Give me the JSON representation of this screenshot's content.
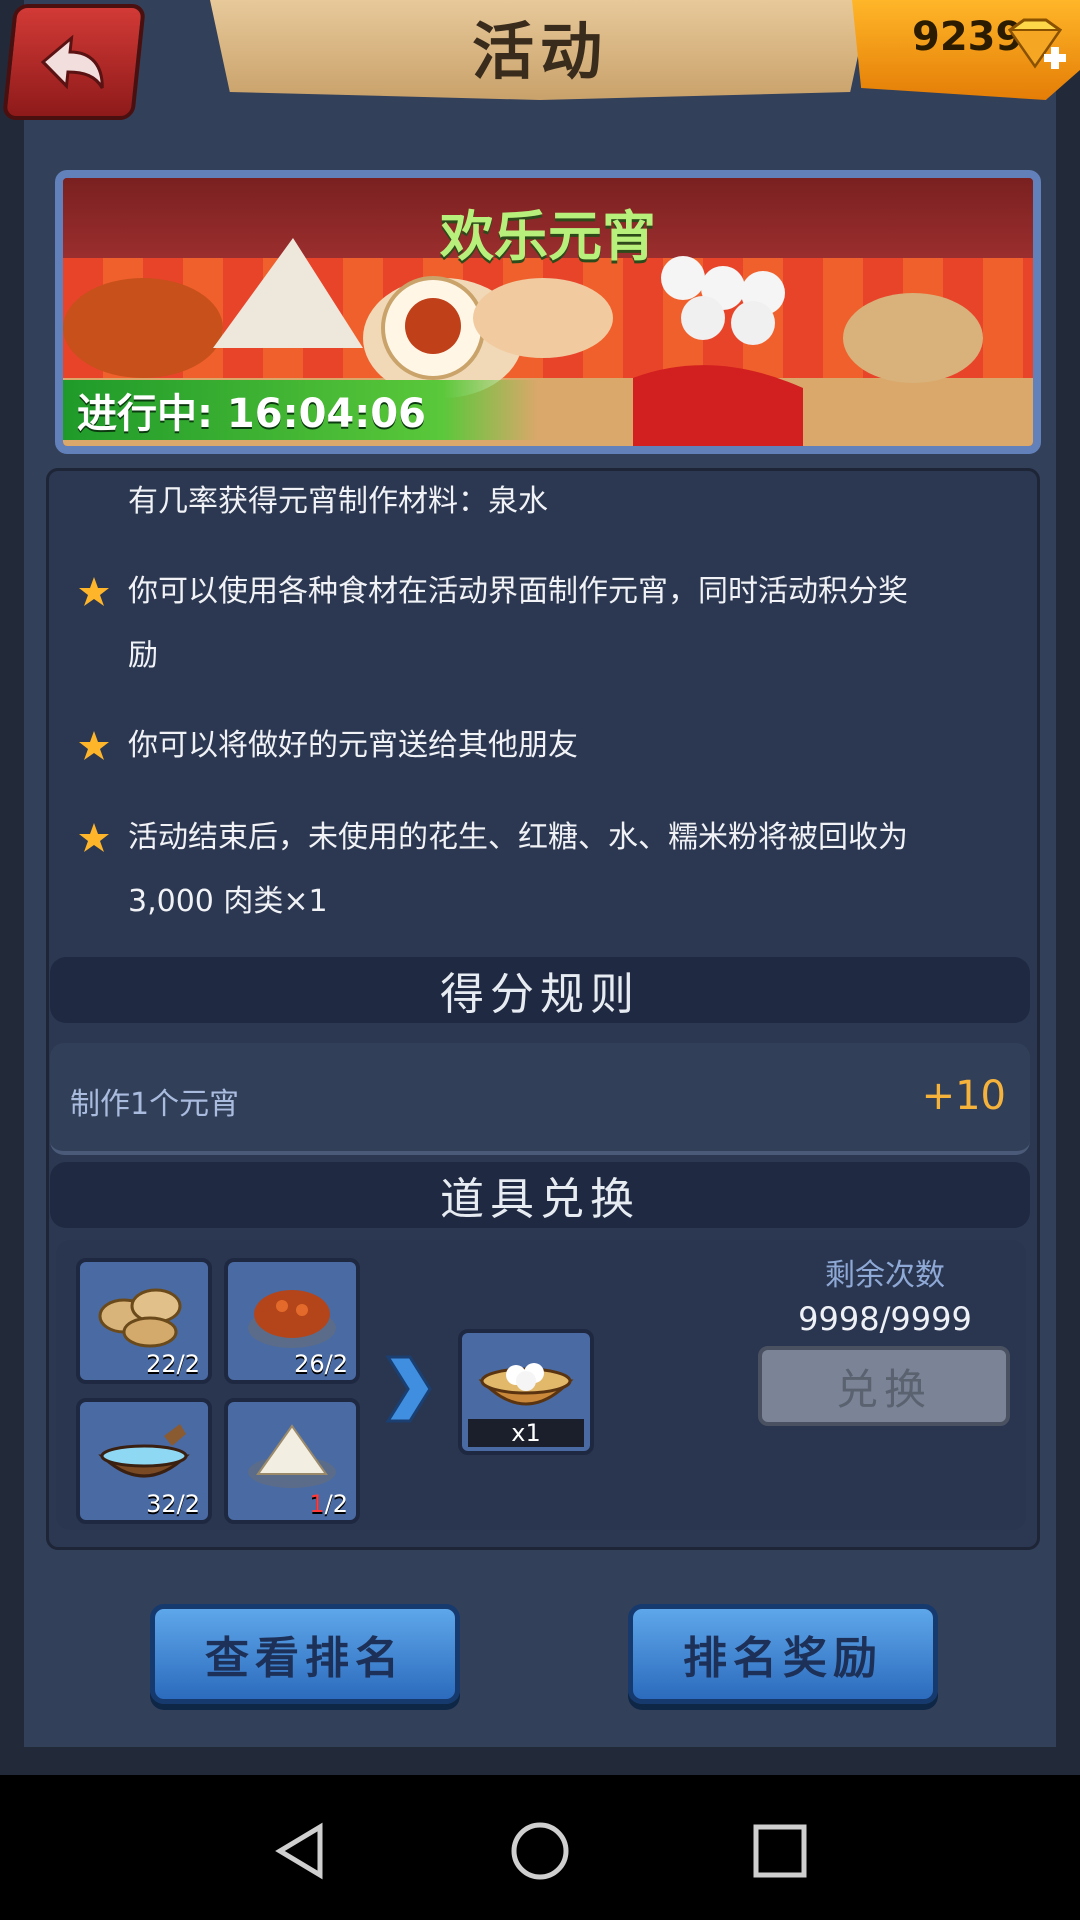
{
  "header": {
    "title": "活动",
    "currency_value": "9239"
  },
  "banner": {
    "title": "欢乐元宵",
    "status": "进行中: 16:04:06"
  },
  "description": {
    "lines": [
      "有几率获得元宵制作材料：泉水",
      "你可以使用各种食材在活动界面制作元宵，同时活动积分奖",
      "励",
      "你可以将做好的元宵送给其他朋友",
      "活动结束后，未使用的花生、红糖、水、糯米粉将被回收为",
      "3,000 肉类×1"
    ]
  },
  "score_rules": {
    "header": "得分规则",
    "row_label": "制作1个元宵",
    "row_value": "+10"
  },
  "exchange": {
    "header": "道具兑换",
    "ingredients": [
      {
        "icon": "peanut-icon",
        "count": "22/2"
      },
      {
        "icon": "brown-sugar-icon",
        "count": "26/2"
      },
      {
        "icon": "water-bowl-icon",
        "count": "32/2"
      },
      {
        "icon": "rice-flour-icon",
        "count_short": "1",
        "count_rest": "/2"
      }
    ],
    "result": {
      "icon": "yuanxiao-bowl-icon",
      "count": "x1"
    },
    "remaining_label": "剩余次数",
    "remaining_value": "9998/9999",
    "button_label": "兑换"
  },
  "actions": {
    "view_ranking": "查看排名",
    "ranking_reward": "排名奖励"
  },
  "colors": {
    "frame": "#33405a",
    "accent_gold": "#f6b33c",
    "banner_green": "#b8f07c",
    "button_blue": "#2c6bbd"
  }
}
